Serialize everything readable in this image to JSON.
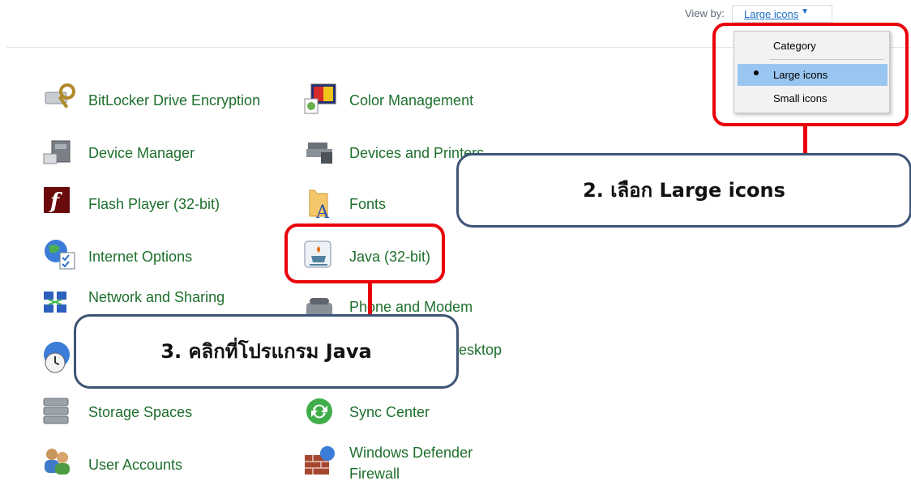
{
  "view_by": {
    "label": "View by:",
    "value": "Large icons",
    "arrow": "▼"
  },
  "dropdown": {
    "options": [
      "Category",
      "Large icons",
      "Small icons"
    ],
    "selected": "Large icons"
  },
  "items": {
    "bitlocker": "BitLocker Drive Encryption",
    "color_management": "Color Management",
    "device_manager": "Device Manager",
    "devices_printers": "Devices and Printers",
    "flash_player": "Flash Player (32-bit)",
    "fonts": "Fonts",
    "internet_options": "Internet Options",
    "java": "Java (32-bit)",
    "network_sharing": "Network and Sharing",
    "phone_modem": "Phone and Modem",
    "remote_desktop_partial": "d Desktop",
    "storage_spaces": "Storage Spaces",
    "sync_center": "Sync Center",
    "user_accounts": "User Accounts",
    "windows_defender_line1": "Windows Defender",
    "windows_defender_line2": "Firewall"
  },
  "annotations": {
    "step2": "2. เลือก Large icons",
    "step3": "3. คลิกที่โปรแกรม Java"
  },
  "colors": {
    "link_green": "#1d6f2c",
    "link_blue": "#1e6fc8",
    "annotation_red": "#e8000b",
    "callout_border": "#3c5476",
    "selected_bg": "#99c6f0"
  },
  "icons": {
    "bitlocker": "bitlocker-key-icon",
    "color_management": "color-management-icon",
    "device_manager": "device-manager-icon",
    "devices_printers": "printer-icon",
    "flash_player": "flash-player-icon",
    "fonts": "fonts-folder-icon",
    "internet_options": "internet-options-globe-icon",
    "java": "java-cup-icon",
    "network_sharing": "network-icon",
    "phone_modem": "phone-icon",
    "clock": "clock-globe-icon",
    "storage_spaces": "storage-drives-icon",
    "sync_center": "sync-icon",
    "user_accounts": "user-accounts-icon",
    "windows_defender": "firewall-icon"
  }
}
